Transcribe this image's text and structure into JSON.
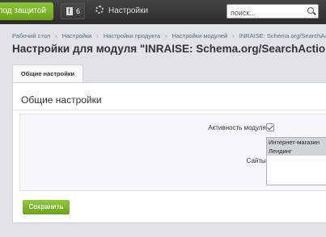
{
  "topbar": {
    "publish_label": "т под защитой",
    "notifications_count": "6",
    "settings_label": "Настройки",
    "search_placeholder": "поиск..."
  },
  "breadcrumb": [
    "Рабочий стол",
    "Настройки",
    "Настройки продукта",
    "Настройки модулей",
    "INRAISE: Schema.org/SearchAction"
  ],
  "page_title": "Настройки для модуля \"INRAISE: Schema.org/SearchAction\"",
  "tab": {
    "label": "Общие настройки"
  },
  "panel": {
    "section_title": "Общие настройки",
    "active_label": "Активность модуля:",
    "active_checked": true,
    "sites_label": "Сайты:",
    "sites_options": [
      "Интернет-магазин",
      "Лендинг"
    ],
    "save_label": "Сохранить"
  },
  "colors": {
    "accent_green": "#7ab828",
    "topbar": "#333333"
  }
}
